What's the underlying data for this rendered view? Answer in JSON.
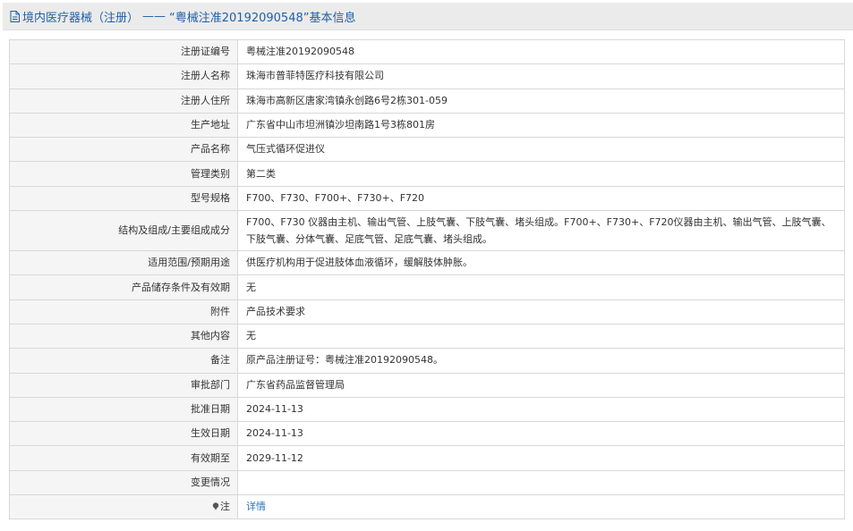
{
  "header": {
    "category": "境内医疗器械（注册）",
    "separator": "——",
    "reg_quote": "“粤械注准20192090548”",
    "suffix": "基本信息",
    "title_color": "#1f5fa8",
    "icon": "document-icon"
  },
  "rows": [
    {
      "label": "注册证编号",
      "value": "粤械注准20192090548"
    },
    {
      "label": "注册人名称",
      "value": "珠海市普菲特医疗科技有限公司"
    },
    {
      "label": "注册人住所",
      "value": "珠海市高新区唐家湾镇永创路6号2栋301-059"
    },
    {
      "label": "生产地址",
      "value": "广东省中山市坦洲镇沙坦南路1号3栋801房"
    },
    {
      "label": "产品名称",
      "value": "气压式循环促进仪"
    },
    {
      "label": "管理类别",
      "value": "第二类"
    },
    {
      "label": "型号规格",
      "value": "F700、F730、F700+、F730+、F720"
    },
    {
      "label": "结构及组成/主要组成成分",
      "value": "F700、F730 仪器由主机、输出气管、上肢气囊、下肢气囊、堵头组成。F700+、F730+、F720仪器由主机、输出气管、上肢气囊、下肢气囊、分体气囊、足底气管、足底气囊、堵头组成。"
    },
    {
      "label": "适用范围/预期用途",
      "value": "供医疗机构用于促进肢体血液循环，缓解肢体肿胀。"
    },
    {
      "label": "产品储存条件及有效期",
      "value": "无"
    },
    {
      "label": "附件",
      "value": "产品技术要求"
    },
    {
      "label": "其他内容",
      "value": "无"
    },
    {
      "label": "备注",
      "value": "原产品注册证号：粤械注准20192090548。"
    },
    {
      "label": "审批部门",
      "value": "广东省药品监督管理局"
    },
    {
      "label": "批准日期",
      "value": "2024-11-13"
    },
    {
      "label": "生效日期",
      "value": "2024-11-13"
    },
    {
      "label": "有效期至",
      "value": "2029-11-12"
    },
    {
      "label": "变更情况",
      "value": ""
    }
  ],
  "note_row": {
    "label": "注",
    "icon": "note-icon",
    "link_text": "详情",
    "link_color": "#2a74b8"
  }
}
